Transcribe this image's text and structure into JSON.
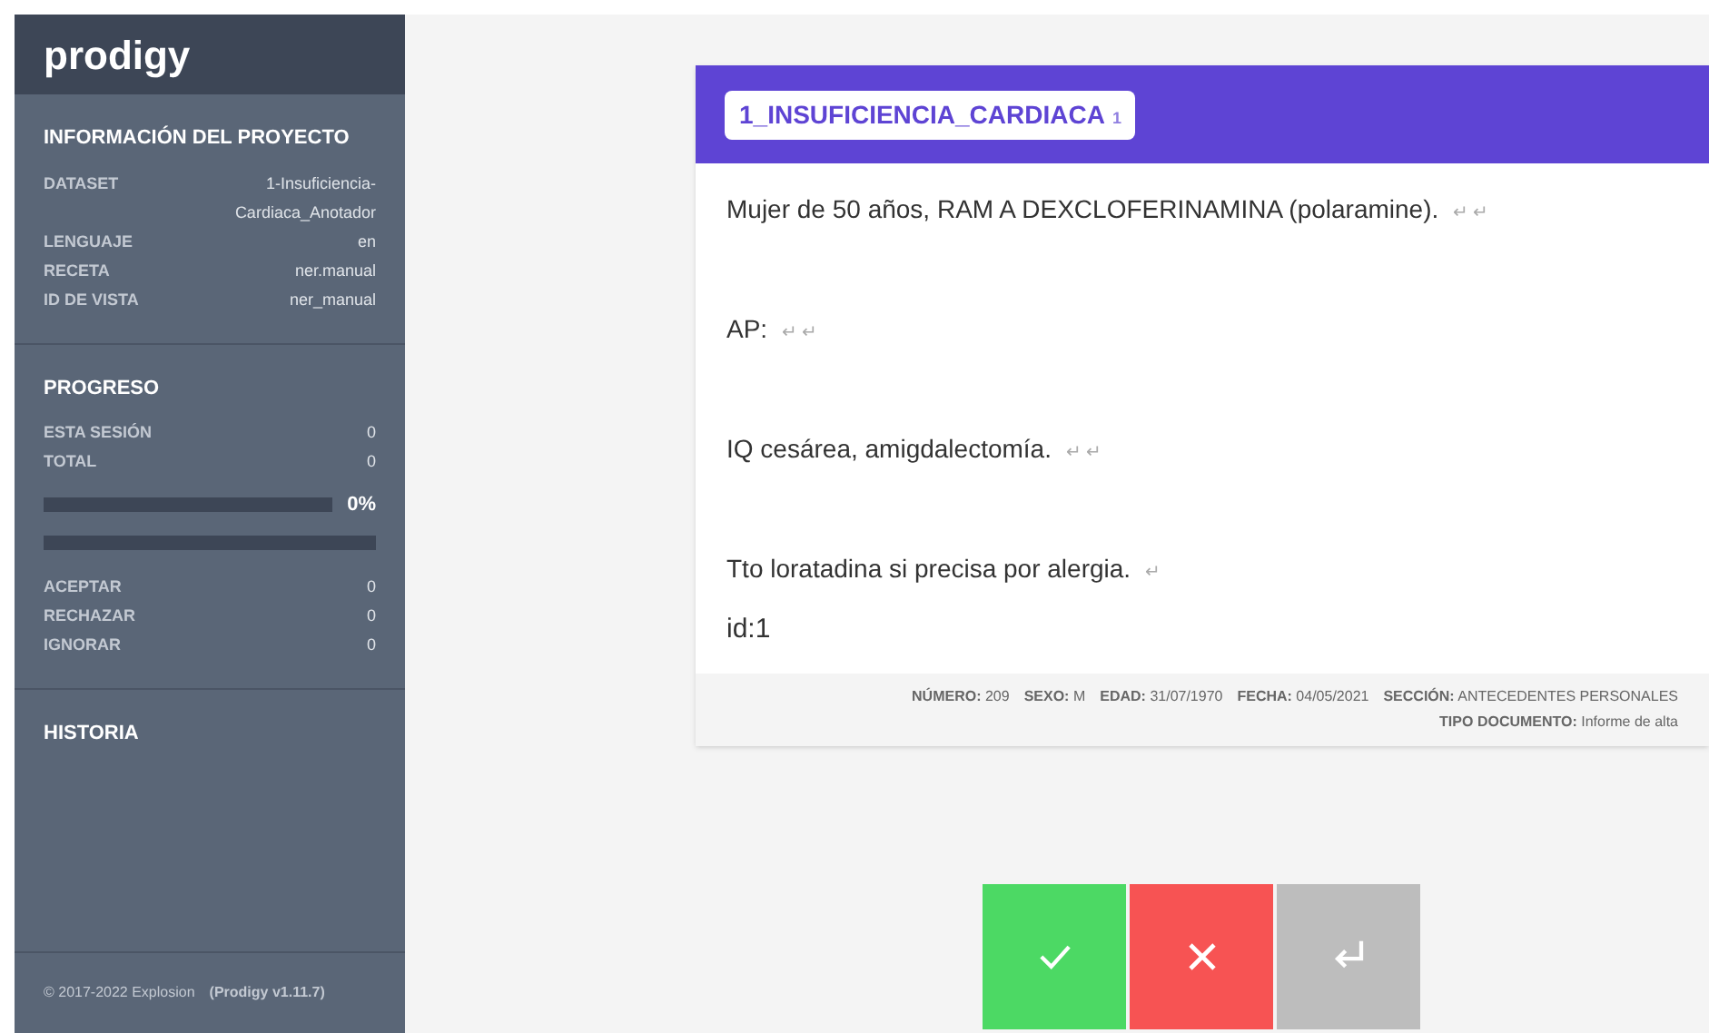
{
  "sidebar": {
    "logo": "prodigy",
    "sections": [
      {
        "kind": "info",
        "title": "INFORMACIÓN DEL PROYECTO",
        "rows": [
          {
            "label": "DATASET",
            "value": "1-Insuficiencia-Cardiaca_Anotador"
          },
          {
            "label": "LENGUAJE",
            "value": "en"
          },
          {
            "label": "RECETA",
            "value": "ner.manual"
          },
          {
            "label": "ID DE VISTA",
            "value": "ner_manual"
          }
        ]
      },
      {
        "kind": "progress",
        "title": "PROGRESO",
        "rows": [
          {
            "label": "ESTA SESIÓN",
            "value": "0"
          },
          {
            "label": "TOTAL",
            "value": "0"
          }
        ],
        "progress": {
          "level": 0,
          "reading": "0%"
        },
        "bar2": {
          "level": 0
        },
        "rows2": [
          {
            "label": "ACEPTAR",
            "value": "0"
          },
          {
            "label": "RECHAZAR",
            "value": "0"
          },
          {
            "label": "IGNORAR",
            "value": "0"
          }
        ]
      },
      {
        "kind": "history",
        "title": "HISTORIA"
      }
    ],
    "footer": {
      "copyright": "© 2017-2022 Explosion",
      "version": "(Prodigy v1.11.7)"
    }
  },
  "card": {
    "label": {
      "text": "1_INSUFICIENCIA_CARDIACA",
      "key": "1"
    },
    "paragraphs": [
      {
        "text": "Mujer de 50 años, RAM A DEXCLOFERINAMINA (polaramine).",
        "marks": "↵ ↵"
      },
      {
        "text": "AP:",
        "marks": "↵ ↵"
      },
      {
        "text": "IQ cesárea, amigdalectomía.",
        "marks": "↵ ↵"
      },
      {
        "text": "Tto loratadina si precisa por alergia.",
        "marks": "↵"
      }
    ],
    "id": "id:1",
    "meta": [
      {
        "key": "NÚMERO:",
        "value": "209"
      },
      {
        "key": "SEXO:",
        "value": "M"
      },
      {
        "key": "EDAD:",
        "value": "31/07/1970"
      },
      {
        "key": "FECHA:",
        "value": "04/05/2021"
      },
      {
        "key": "SECCIÓN:",
        "value": "ANTECEDENTES PERSONALES"
      },
      {
        "key": "TIPO DOCUMENTO:",
        "value": "Informe de alta"
      }
    ]
  },
  "buttons": [
    {
      "kind": "accept"
    },
    {
      "kind": "reject"
    },
    {
      "kind": "ignore"
    }
  ]
}
